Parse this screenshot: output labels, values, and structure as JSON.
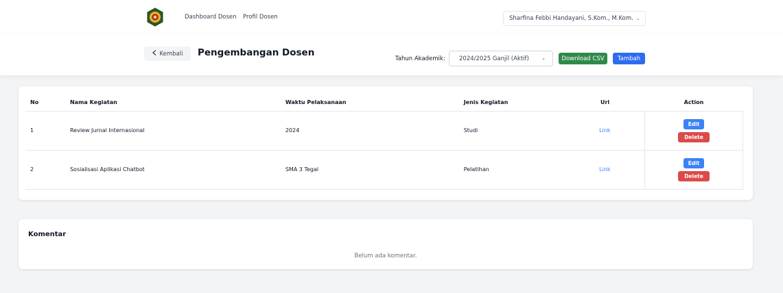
{
  "nav": {
    "logo": "university-seal",
    "links": [
      "Dashboard Dosen",
      "Profil Dosen"
    ],
    "user": "Sharfina Febbi Handayani, S.Kom., M.Kom."
  },
  "header": {
    "back_label": "Kembali",
    "title": "Pengembangan Dosen",
    "year_label": "Tahun Akademik:",
    "year_value": "2024/2025 Ganjil (Aktif)",
    "download_label": "Download CSV",
    "add_label": "Tambah"
  },
  "table": {
    "headers": [
      "No",
      "Nama Kegiatan",
      "Waktu Pelaksanaan",
      "Jenis Kegiatan",
      "Url",
      "Action"
    ],
    "rows": [
      {
        "no": "1",
        "name": "Review Jurnal Internasional",
        "time": "2024",
        "type": "Studi",
        "url": "Link"
      },
      {
        "no": "2",
        "name": "Sosialisasi Aplikasi Chatbot",
        "time": "SMA 3 Tegal",
        "type": "Pelatihan",
        "url": "Link"
      }
    ],
    "edit_label": "Edit",
    "delete_label": "Delete"
  },
  "comments": {
    "title": "Komentar",
    "empty": "Belum ada komentar."
  },
  "colors": {
    "csv_button": "#2f8a4a",
    "add_button": "#2f6bf0",
    "edit_button": "#3b82f6",
    "delete_button": "#dc4a4a",
    "link": "#3b82f6"
  }
}
